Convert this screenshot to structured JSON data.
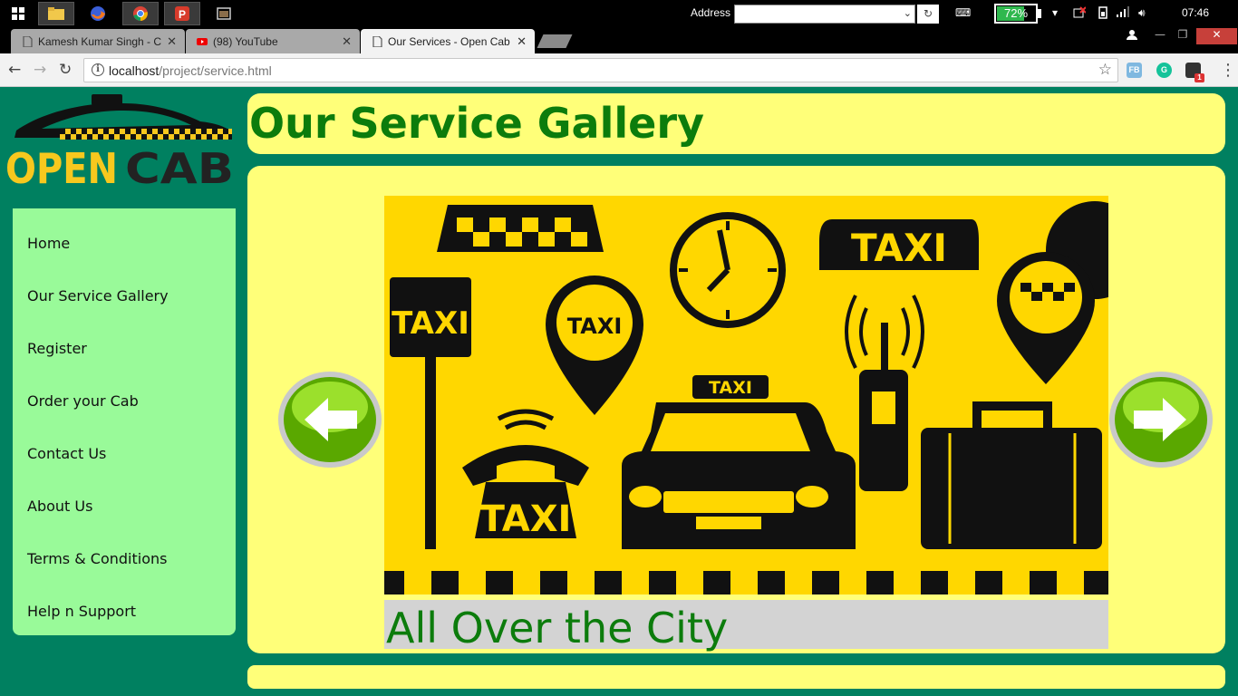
{
  "taskbar": {
    "address_label": "Address",
    "address_value": "",
    "battery_percent": 72,
    "battery_label": "72%",
    "clock": "07:46"
  },
  "browser": {
    "tabs": [
      {
        "title": "Kamesh Kumar Singh - C",
        "active": false
      },
      {
        "title": "(98) YouTube",
        "active": false
      },
      {
        "title": "Our Services - Open Cab",
        "active": true
      }
    ],
    "url_host": "localhost",
    "url_path": "/project/service.html",
    "extension_badge": "1"
  },
  "site": {
    "logo": {
      "line1": "OPEN",
      "line2": "CAB"
    },
    "nav": [
      {
        "label": "Home"
      },
      {
        "label": "Our Service Gallery"
      },
      {
        "label": "Register"
      },
      {
        "label": "Order your Cab"
      },
      {
        "label": "Contact Us"
      },
      {
        "label": "About Us"
      },
      {
        "label": "Terms & Conditions"
      },
      {
        "label": "Help n Support"
      }
    ],
    "page_title": "Our Service Gallery",
    "slide": {
      "caption": "All Over the City",
      "sign_texts": [
        "TAXI",
        "TAXI",
        "TAXI",
        "TAXI",
        "TAXI"
      ]
    }
  },
  "colors": {
    "page_bg": "#008060",
    "panel_bg": "#ffff79",
    "nav_bg": "#99fa99",
    "title_green": "#0c7c0c",
    "slide_yellow": "#ffd700"
  }
}
